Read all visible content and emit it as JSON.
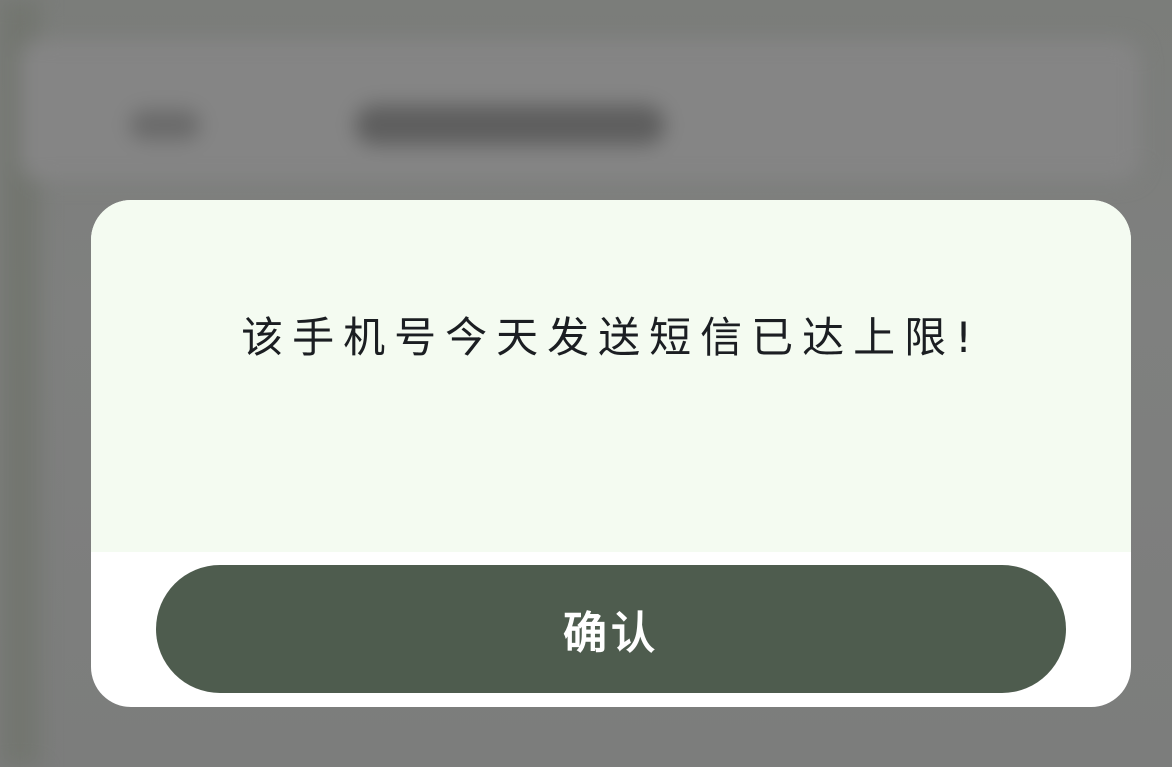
{
  "dialog": {
    "message": "该手机号今天发送短信已达上限!",
    "confirm_label": "确认"
  },
  "colors": {
    "overlay": "#7a7b7a",
    "dialog_body": "#f4fbf1",
    "dialog_footer": "#ffffff",
    "button": "#4e5c4e",
    "button_text": "#ffffff",
    "message_text": "#1b1e22"
  }
}
